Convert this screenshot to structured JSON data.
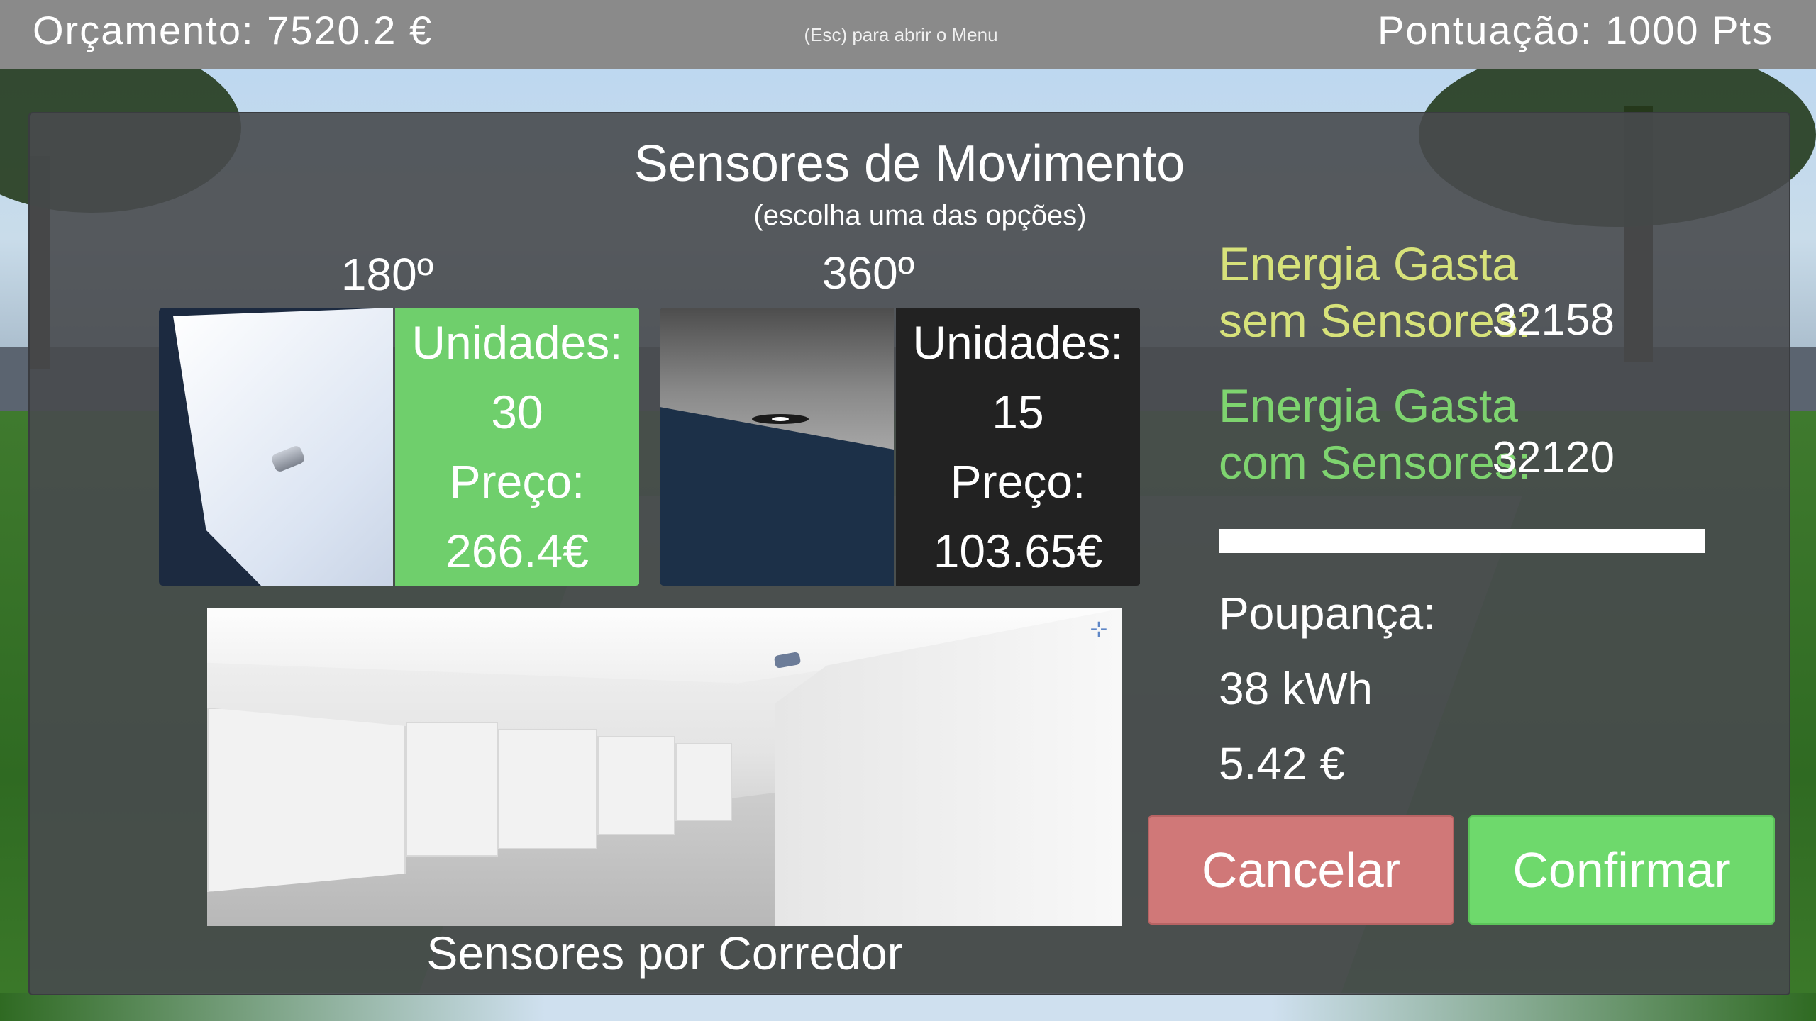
{
  "hud": {
    "budget": "Orçamento: 7520.2 €",
    "menu_hint": "(Esc) para abrir o Menu",
    "score": "Pontuação: 1000 Pts"
  },
  "dialog": {
    "title": "Sensores de Movimento",
    "subtitle": "(escolha uma das opções)",
    "options": [
      {
        "label": "180º",
        "units_label": "Unidades:",
        "units": "30",
        "price_label": "Preço:",
        "price": "266.4€",
        "selected": true
      },
      {
        "label": "360º",
        "units_label": "Unidades:",
        "units": "15",
        "price_label": "Preço:",
        "price": "103.65€",
        "selected": false
      }
    ],
    "corridor_caption": "Sensores por Corredor",
    "energy": {
      "without_line1": "Energia Gasta",
      "without_line2": "sem Sensores:",
      "without_value": "32158",
      "with_line1": "Energia Gasta",
      "with_line2": "com Sensores:",
      "with_value": "32120",
      "ratio_fill": 1.0
    },
    "savings": {
      "label": "Poupança:",
      "energy": "38 kWh",
      "money": "5.42 €"
    },
    "buttons": {
      "cancel": "Cancelar",
      "confirm": "Confirmar"
    }
  },
  "colors": {
    "selected_green": "#6fcf6c",
    "cancel_red": "#d07878",
    "confirm_green": "#6ed96c",
    "label_yellow": "#d7e27a",
    "label_green": "#7ed46f"
  }
}
